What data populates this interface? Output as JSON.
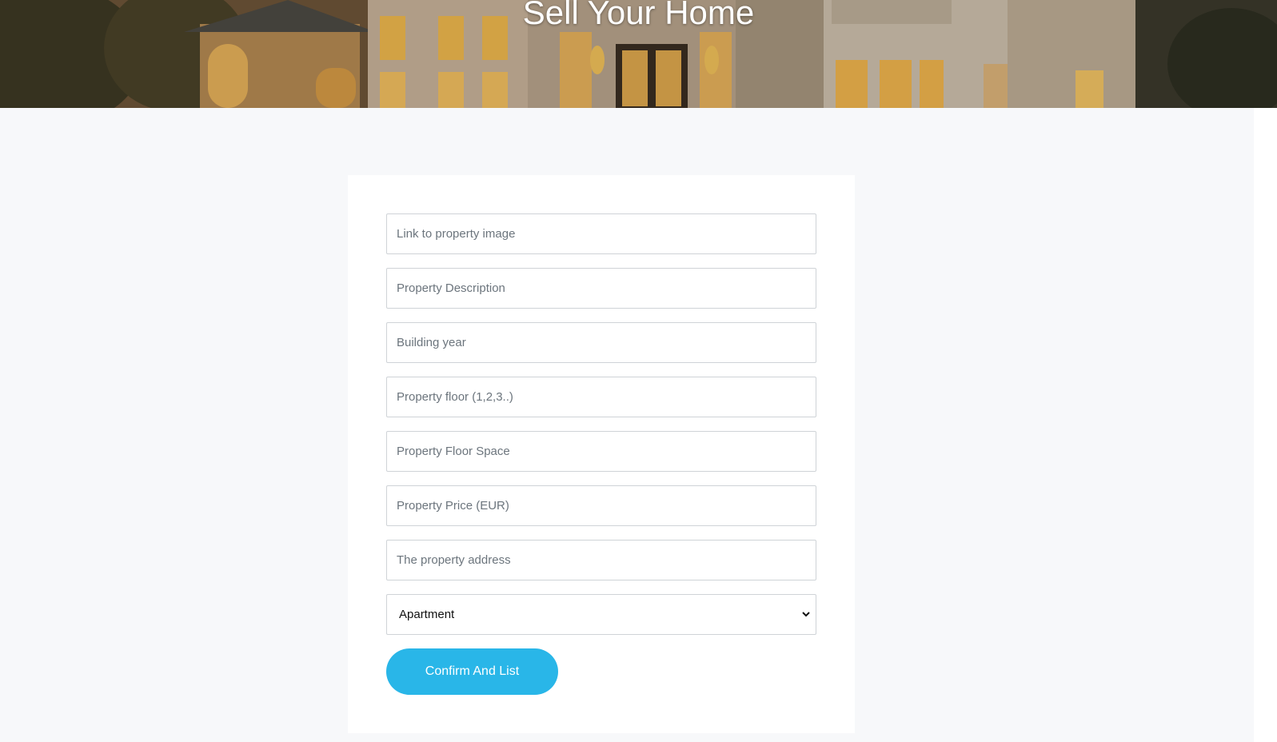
{
  "hero": {
    "title": "Sell Your Home"
  },
  "form": {
    "fields": [
      {
        "placeholder": "Link to property image",
        "value": ""
      },
      {
        "placeholder": "Property Description",
        "value": ""
      },
      {
        "placeholder": "Building year",
        "value": ""
      },
      {
        "placeholder": "Property floor (1,2,3..)",
        "value": ""
      },
      {
        "placeholder": "Property Floor Space",
        "value": ""
      },
      {
        "placeholder": "Property Price (EUR)",
        "value": ""
      },
      {
        "placeholder": "The property address",
        "value": ""
      }
    ],
    "property_type": {
      "selected": "Apartment",
      "icon": "chevron-down-icon"
    },
    "submit_label": "Confirm And List"
  },
  "colors": {
    "accent": "#29b6e8",
    "page_background": "#f7f8fa",
    "card_background": "#ffffff"
  }
}
